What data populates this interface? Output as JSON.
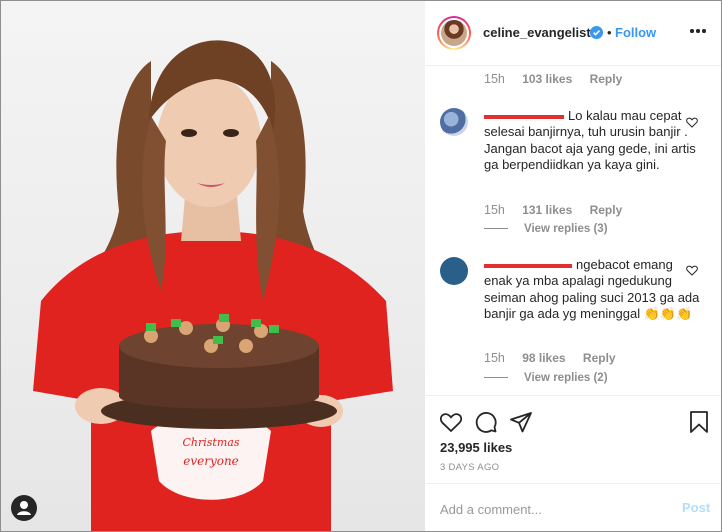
{
  "post": {
    "username": "celine_evangelista",
    "separator": "•",
    "follow_label": "Follow",
    "likes_total": "23,995 likes",
    "date": "3 DAYS AGO",
    "photo_text": "everyone",
    "photo_text_top": "Christmas"
  },
  "comments": [
    {
      "meta_time": "15h",
      "meta_likes": "103 likes",
      "meta_reply": "Reply"
    },
    {
      "text": "Lo kalau mau cepat selesai banjirnya, tuh urusin banjir . Jangan bacot aja yang gede, ini artis ga berpendiidkan ya kaya gini.",
      "time": "15h",
      "likes": "131 likes",
      "reply": "Reply",
      "view_replies": "View replies (3)"
    },
    {
      "text": "ngebacot emang enak ya mba apalagi ngedukung seiman ahog paling suci 2013 ga ada banjir ga ada yg meninggal 👏👏👏",
      "time": "15h",
      "likes": "98 likes",
      "reply": "Reply",
      "view_replies": "View replies (2)"
    }
  ],
  "composer": {
    "placeholder": "Add a comment...",
    "post_label": "Post"
  },
  "colors": {
    "accent": "#3897f0",
    "redaction": "#e03030",
    "shirt": "#e0231f"
  },
  "icons": {
    "header": [
      "verified-badge-icon",
      "more-options-icon"
    ],
    "actions": [
      "heart-icon",
      "comment-icon",
      "share-icon",
      "bookmark-icon"
    ]
  }
}
